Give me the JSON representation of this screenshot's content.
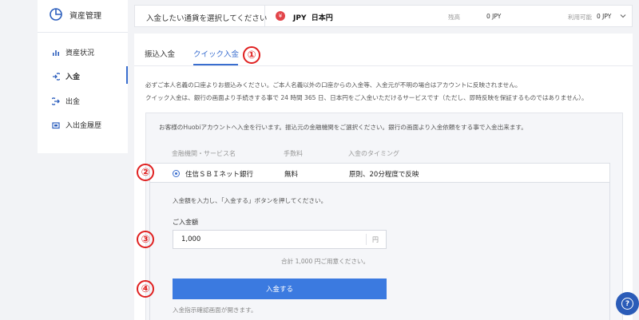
{
  "sidebar": {
    "title": "資産管理",
    "items": [
      {
        "label": "資産状況",
        "icon": "bar-chart-icon",
        "active": false
      },
      {
        "label": "入金",
        "icon": "deposit-icon",
        "active": true
      },
      {
        "label": "出金",
        "icon": "withdraw-icon",
        "active": false
      },
      {
        "label": "入出金履歴",
        "icon": "history-icon",
        "active": false
      }
    ]
  },
  "currency_bar": {
    "prompt": "入金したい通貨を選択してください",
    "currency_symbol": "¥",
    "currency_code": "JPY",
    "currency_name": "日本円",
    "balance_label": "残高",
    "balance_value": "0 JPY",
    "available_label": "利用可能",
    "available_value": "0 JPY"
  },
  "tabs": [
    {
      "label": "振込入金",
      "active": false
    },
    {
      "label": "クイック入金",
      "active": true
    }
  ],
  "notices": [
    "必ずご本人名義の口座よりお振込みください。ご本人名義以外の口座からの入金等、入金元が不明の場合はアカウントに反映されません。",
    "クイック入金は、銀行の画面より手続きする事で 24 時間 365 日、日本円をご入金いただけるサービスです（ただし、即時反映を保証するものではありません）。"
  ],
  "panel": {
    "info": "お客様のHuobiアカウントへ入金を行います。振込元の金融機関をご選択ください。銀行の画面より入金依頼をする事で入金出来ます。",
    "columns": [
      "金融機関・サービス名",
      "手数料",
      "入金のタイミング"
    ],
    "bank": {
      "name": "住信ＳＢＩネット銀行",
      "fee": "無料",
      "timing": "原則、20分程度で反映"
    },
    "form_note": "入金額を入力し、「入金する」ボタンを押してください。",
    "amount_label": "ご入金額",
    "amount_value": "1,000",
    "amount_unit": "円",
    "total_note": "合計 1,000 円ご用意ください。",
    "submit_label": "入金する",
    "submit_note": "入金指示確認画面が開きます。"
  },
  "markers": [
    "①",
    "②",
    "③",
    "④"
  ],
  "colors": {
    "accent": "#3b7ae0",
    "marker": "#e02020",
    "yen_badge": "#e2454a"
  }
}
